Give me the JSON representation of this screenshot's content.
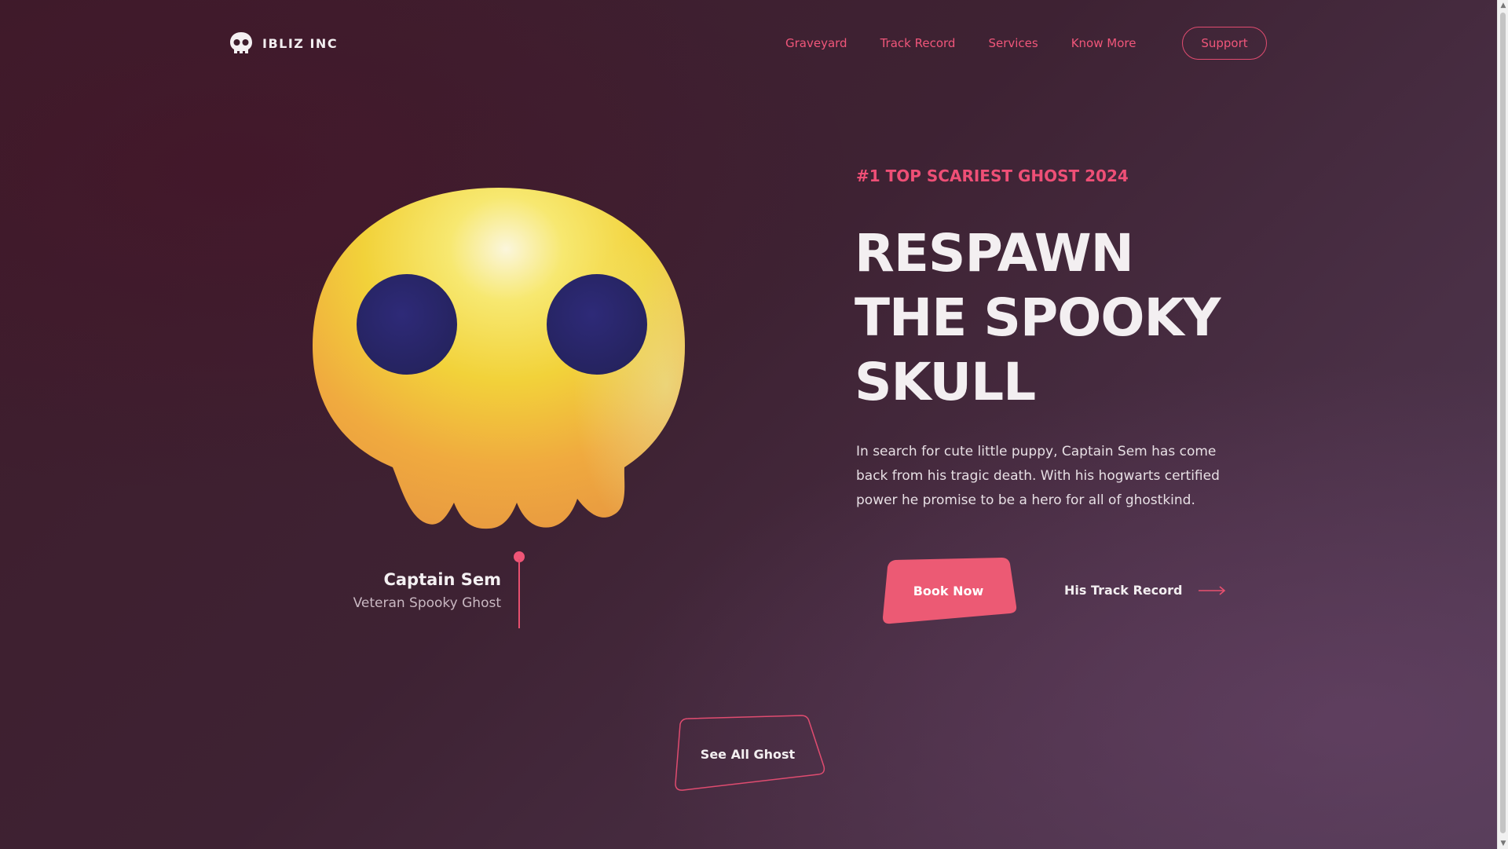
{
  "header": {
    "brand": "IBLIZ INC",
    "brand_icon": "skull-icon",
    "nav": [
      "Graveyard",
      "Track Record",
      "Services",
      "Know More"
    ],
    "support_label": "Support"
  },
  "hero": {
    "eyebrow": "#1 TOP SCARIEST GHOST 2024",
    "headline": [
      "RESPAWN",
      "THE SPOOKY",
      "SKULL"
    ],
    "description": "In search for cute little puppy, Captain Sem has come back from his tragic death. With his hogwarts certified power he promise to be a hero for all of ghostkind.",
    "book_label": "Book Now",
    "track_label": "His Track Record",
    "track_icon": "arrow-right-icon"
  },
  "character": {
    "name": "Captain Sem",
    "role": "Veteran Spooky Ghost",
    "illustration": "skull-illustration"
  },
  "footer_cta": {
    "label": "See All Ghost"
  },
  "colors": {
    "accent": "#ee4f76",
    "background": "#3e2233",
    "skull_yellow": "#f2d23a",
    "skull_orange": "#f0a83c",
    "eye": "#2b2870"
  }
}
